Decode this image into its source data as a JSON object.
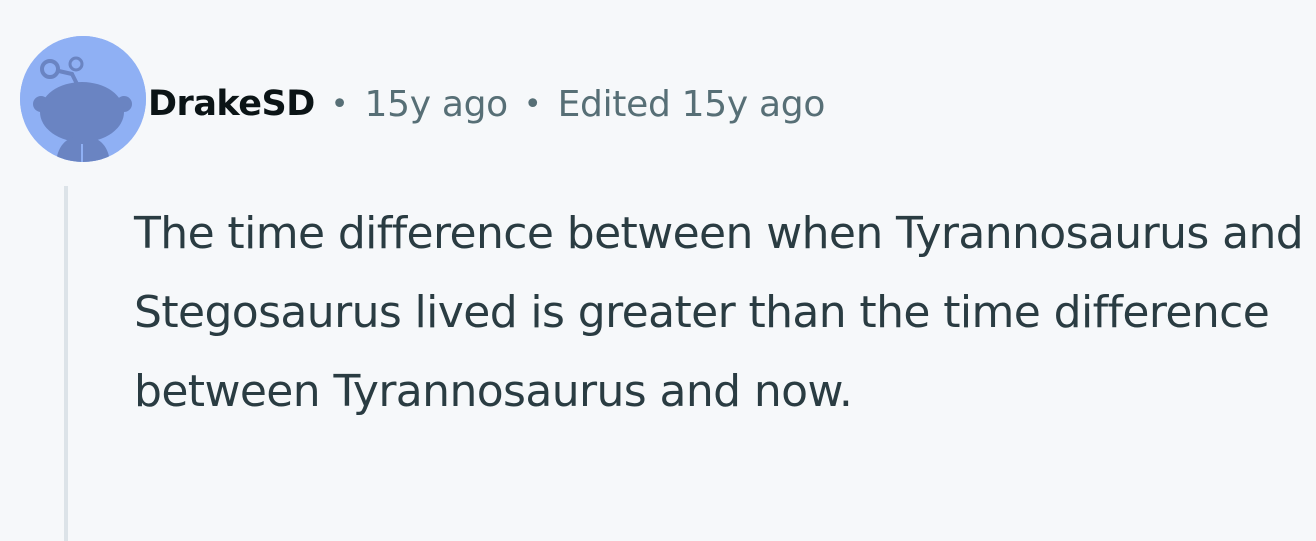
{
  "comment": {
    "author": "DrakeSD",
    "separator": "•",
    "posted": "15y ago",
    "edited": "Edited 15y ago",
    "body": "The time difference between when Tyrannosaurus and Stegosaurus lived is greater than the time difference between Tyrannosaurus and now.",
    "avatar_icon": "snoo-avatar-icon",
    "colors": {
      "avatar_bg": "#8fb0f4",
      "avatar_figure": "#6a84c2",
      "author": "#0b1416",
      "meta": "#576f76",
      "body": "#2a3c42",
      "thread_line": "#dce3e8",
      "background": "#f6f8fa"
    }
  }
}
